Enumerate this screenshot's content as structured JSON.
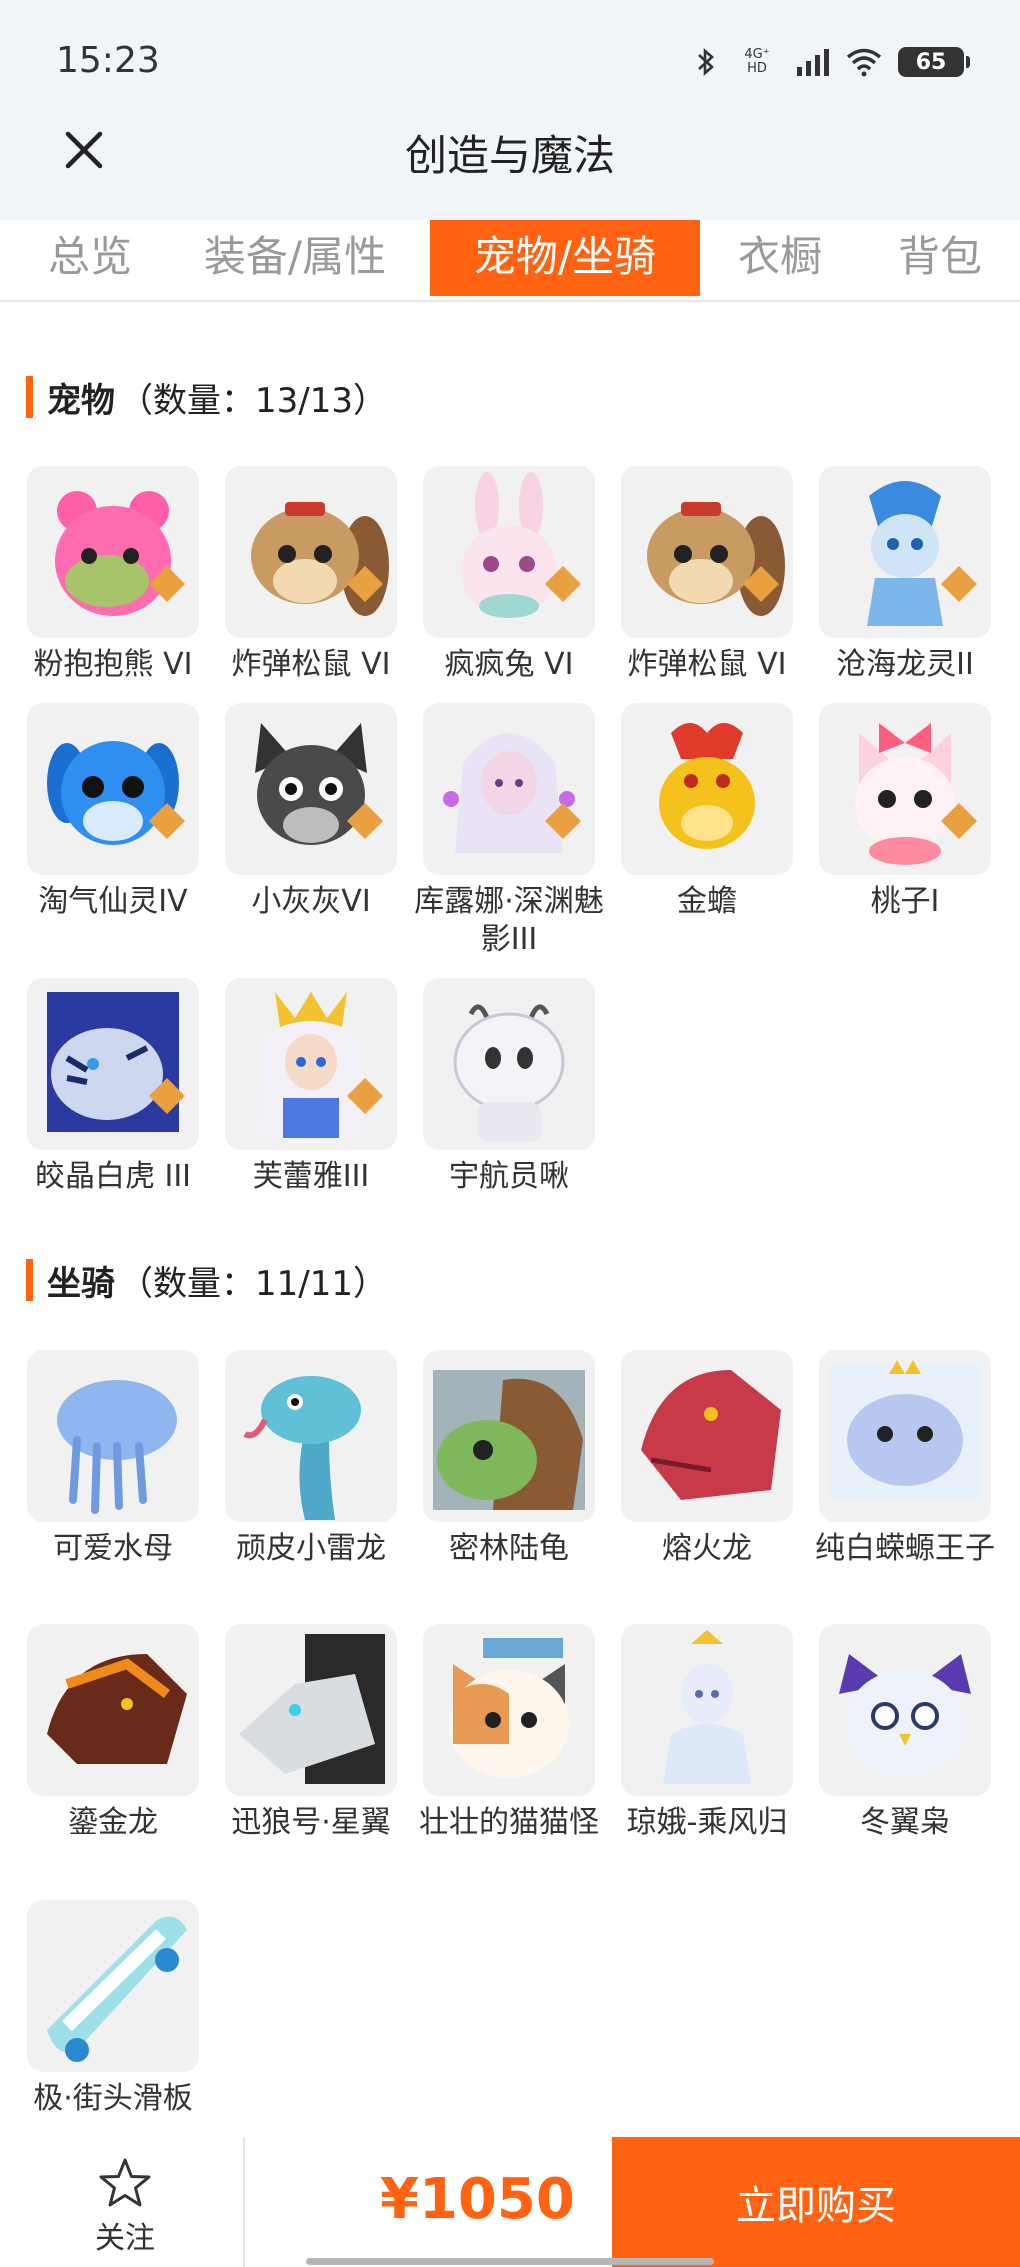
{
  "status_bar": {
    "time": "15:23",
    "network": "4G⁺ HD",
    "battery": "65"
  },
  "header": {
    "title": "创造与魔法"
  },
  "tabs": [
    {
      "label": "总览"
    },
    {
      "label": "装备/属性"
    },
    {
      "label": "宠物/坐骑"
    },
    {
      "label": "衣橱"
    },
    {
      "label": "背包"
    }
  ],
  "pets": {
    "title": "宠物",
    "count": "（数量：13/13）",
    "items": [
      {
        "name": "粉抱抱熊 VI"
      },
      {
        "name": "炸弹松鼠 VI"
      },
      {
        "name": "疯疯兔 VI"
      },
      {
        "name": "炸弹松鼠 VI"
      },
      {
        "name": "沧海龙灵II"
      },
      {
        "name": "淘气仙灵IV"
      },
      {
        "name": "小灰灰VI"
      },
      {
        "name": "库露娜·深渊魅影III"
      },
      {
        "name": "金蟾"
      },
      {
        "name": "桃子I"
      },
      {
        "name": "皎晶白虎 III"
      },
      {
        "name": "芙蕾雅III"
      },
      {
        "name": "宇航员啾"
      }
    ]
  },
  "mounts": {
    "title": "坐骑",
    "count": "（数量：11/11）",
    "items": [
      {
        "name": "可爱水母"
      },
      {
        "name": "顽皮小雷龙"
      },
      {
        "name": "密林陆龟"
      },
      {
        "name": "熔火龙"
      },
      {
        "name": "纯白蝾螈王子"
      },
      {
        "name": "鎏金龙"
      },
      {
        "name": "迅狼号·星翼"
      },
      {
        "name": "壮壮的猫猫怪"
      },
      {
        "name": "琼娥-乘风归"
      },
      {
        "name": "冬翼枭"
      },
      {
        "name": "极·街头滑板"
      }
    ]
  },
  "footer": {
    "follow_label": "关注",
    "price": "¥1050",
    "buy_label": "立即购买"
  },
  "colors": {
    "accent": "#ff6311",
    "header_bg": "#f1f4f8",
    "thumb_bg": "#f1f1f1"
  },
  "icons": {
    "close": "close-icon",
    "star": "star-icon",
    "bluetooth": "bluetooth-icon",
    "signal": "signal-icon",
    "wifi": "wifi-icon",
    "battery": "battery-icon"
  }
}
